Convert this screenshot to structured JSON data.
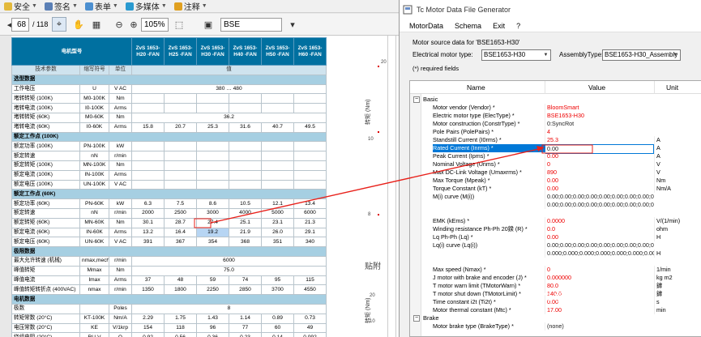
{
  "pdf_toolbar": {
    "menus": [
      {
        "label": "安全",
        "icon": "shield-icon"
      },
      {
        "label": "签名",
        "icon": "pen-icon"
      },
      {
        "label": "表单",
        "icon": "form-icon"
      },
      {
        "label": "多媒体",
        "icon": "media-icon"
      },
      {
        "label": "注释",
        "icon": "comment-icon"
      }
    ],
    "page_current": "68",
    "page_total": "/ 118",
    "zoom": "105%",
    "search_value": "BSE"
  },
  "datasheet": {
    "header": {
      "title": "电机型号",
      "models": [
        "ZvS 1653-H20 -FAN",
        "ZvS 1653-H25 -FAN",
        "ZvS 1653-H30 -FAN",
        "ZvS 1653-H40 -FAN",
        "ZvS 1653-H50 -FAN",
        "ZvS 1653-H60 -FAN"
      ]
    },
    "subheader": [
      "技术参数",
      "缩写符号",
      "单位",
      "值"
    ],
    "rows": [
      {
        "type": "sec",
        "label": "选型数据"
      },
      {
        "label": "工作电压",
        "sym": "U",
        "unit": "V AC",
        "span": "380 … 480"
      },
      {
        "label": "堵转转矩 (100K)",
        "sym": "M0-100K",
        "unit": "Nm",
        "vals": [
          "",
          "",
          "",
          "",
          "",
          ""
        ]
      },
      {
        "label": "堵转电流 (100K)",
        "sym": "I0-100K",
        "unit": "Arms",
        "vals": [
          "",
          "",
          "",
          "",
          "",
          ""
        ]
      },
      {
        "label": "堵转转矩 (60K)",
        "sym": "M0-60K",
        "unit": "Nm",
        "span": "36.2"
      },
      {
        "label": "堵转电流 (60K)",
        "sym": "I0-60K",
        "unit": "Arms",
        "vals": [
          "15.8",
          "20.7",
          "25.3",
          "31.6",
          "40.7",
          "49.5"
        ]
      },
      {
        "type": "sec",
        "label": "额定工作点 (100K)"
      },
      {
        "label": "额定功率 (100K)",
        "sym": "PN-100K",
        "unit": "kW",
        "vals": [
          "",
          "",
          "",
          "",
          "",
          ""
        ]
      },
      {
        "label": "额定转速",
        "sym": "nN",
        "unit": "r/min",
        "vals": [
          "",
          "",
          "",
          "",
          "",
          ""
        ]
      },
      {
        "label": "额定转矩 (100K)",
        "sym": "MN-100K",
        "unit": "Nm",
        "vals": [
          "",
          "",
          "",
          "",
          "",
          ""
        ]
      },
      {
        "label": "额定电流 (100K)",
        "sym": "IN-100K",
        "unit": "Arms",
        "vals": [
          "",
          "",
          "",
          "",
          "",
          ""
        ]
      },
      {
        "label": "额定电压 (100K)",
        "sym": "UN-100K",
        "unit": "V AC",
        "vals": [
          "",
          "",
          "",
          "",
          "",
          ""
        ]
      },
      {
        "type": "sec",
        "label": "额定工作点 (60K)"
      },
      {
        "label": "额定功率 (60K)",
        "sym": "PN-60K",
        "unit": "kW",
        "vals": [
          "6.3",
          "7.5",
          "8.6",
          "10.5",
          "12.1",
          "13.4"
        ]
      },
      {
        "label": "额定转速",
        "sym": "nN",
        "unit": "r/min",
        "vals": [
          "2000",
          "2500",
          "3000",
          "4000",
          "5000",
          "6000"
        ]
      },
      {
        "label": "额定转矩 (60K)",
        "sym": "MN-60K",
        "unit": "Nm",
        "vals": [
          "30.1",
          "28.7",
          "27.4",
          "25.1",
          "23.1",
          "21.3"
        ]
      },
      {
        "label": "额定电流 (60K)",
        "sym": "IN-60K",
        "unit": "Arms",
        "vals": [
          "13.2",
          "16.4",
          "19.2",
          "21.9",
          "26.0",
          "29.1"
        ],
        "hl": 2
      },
      {
        "label": "额定电压 (60K)",
        "sym": "UN-60K",
        "unit": "V AC",
        "vals": [
          "391",
          "367",
          "354",
          "368",
          "351",
          "340"
        ]
      },
      {
        "type": "sec",
        "label": "极限数据"
      },
      {
        "label": "最大允许转速 (机械)",
        "sym": "nmax,mech",
        "unit": "r/min",
        "span": "6000"
      },
      {
        "label": "峰值转矩",
        "sym": "Mmax",
        "unit": "Nm",
        "span": "75.0"
      },
      {
        "label": "峰值电流",
        "sym": "Imax",
        "unit": "Arms",
        "vals": [
          "37",
          "48",
          "59",
          "74",
          "95",
          "115"
        ]
      },
      {
        "label": "峰值转矩转折点 (400VAC)",
        "sym": "nmax",
        "unit": "r/min",
        "vals": [
          "1350",
          "1800",
          "2250",
          "2850",
          "3700",
          "4550"
        ]
      },
      {
        "type": "sec",
        "label": "电机数据"
      },
      {
        "label": "极数",
        "sym": "",
        "unit": "Poles",
        "span": "8"
      },
      {
        "label": "转矩常数 (20°C)",
        "sym": "KT-100K",
        "unit": "Nm/A",
        "vals": [
          "2.29",
          "1.75",
          "1.43",
          "1.14",
          "0.89",
          "0.73"
        ]
      },
      {
        "label": "电压常数 (20°C)",
        "sym": "KE",
        "unit": "V/1krp",
        "vals": [
          "154",
          "118",
          "96",
          "77",
          "60",
          "49"
        ]
      },
      {
        "label": "绕组电阻 (20°C)",
        "sym": "RU-V",
        "unit": "Ω",
        "vals": [
          "0.92",
          "0.56",
          "0.36",
          "0.23",
          "0.14",
          "0.092"
        ]
      },
      {
        "label": "绕组电感 (20°C)",
        "sym": "LU-V",
        "unit": "mH",
        "vals": [
          "19.2",
          "11.2",
          "7.50",
          "4.80",
          "2.90",
          "1.96"
        ]
      }
    ]
  },
  "chart_strip": {
    "numbers": [
      "20",
      "10",
      "8",
      "20",
      "10"
    ],
    "axis_titles": [
      "转矩 (Nm)",
      "转矩 (Nm)"
    ],
    "chinese_text": "贴附"
  },
  "tc": {
    "title": "Tc Motor Data File Generator",
    "menu": [
      "MotorData",
      "Schema",
      "Exit",
      "?"
    ],
    "source_text": "Motor source data for 'BSE1653-H30'",
    "elec_label": "Electrical motor type:",
    "elec_value": "BSE1653-H30",
    "assy_label": "AssemblyType:",
    "assy_value": "BSE1653-H30_Assembly",
    "required_text": "(*) required fields",
    "columns": [
      "Name",
      "Value",
      "Unit"
    ],
    "cat_basic": "Basic",
    "cat_brake": "Brake",
    "rows": [
      {
        "n": "Motor vendor (Vendor) *",
        "v": "BloomSmart",
        "u": "",
        "vc": "red"
      },
      {
        "n": "Electric motor type (ElecType) *",
        "v": "BSE1653-H30",
        "u": "",
        "vc": "red"
      },
      {
        "n": "Motor construction (ConstrType) *",
        "v": "0:SyncRot",
        "u": "",
        "vc": "blk"
      },
      {
        "n": "Pole Pairs (PolePairs) *",
        "v": "4",
        "u": "",
        "vc": "red"
      },
      {
        "n": "Standstill Current (I0rms) *",
        "v": "25.3",
        "u": "A",
        "vc": "red"
      },
      {
        "n": "Rated Current (Inrms) *",
        "v": "0.00",
        "u": "A",
        "vc": "blk",
        "sel": true
      },
      {
        "n": "Peak Current (Ipms) *",
        "v": "0.00",
        "u": "A",
        "vc": "red"
      },
      {
        "n": "Nominal Voltage (Unms) *",
        "v": "0",
        "u": "V",
        "vc": "red"
      },
      {
        "n": "Max DC-Link Voltage (Umaxrms) *",
        "v": "890",
        "u": "V",
        "vc": "red"
      },
      {
        "n": "Max Torque (Mpeak) *",
        "v": "0.00",
        "u": "Nm",
        "vc": "red"
      },
      {
        "n": "Torque Constant (kT) *",
        "v": "0.00",
        "u": "Nm/A",
        "vc": "red"
      },
      {
        "n": "M(i) curve (M(i))",
        "v": "0.00;0.00;0.00;0.00;0.00;0.00;0.00;0.00;0.00;0.",
        "u": "",
        "vc": "blk"
      },
      {
        "n": "",
        "v": "0.00;0.00;0.00;0.00;0.00;0.00;0.00;0.00;0.00;0.",
        "u": "",
        "vc": "blk"
      },
      {
        "n": "",
        "v": "",
        "u": "",
        "vc": "blk"
      },
      {
        "n": "EMK (kEms) *",
        "v": "0.0000",
        "u": "V/(1/min)",
        "vc": "red"
      },
      {
        "n": "Winding resistance Ph-Ph 20鍨 (R) *",
        "v": "0.0",
        "u": "ohm",
        "vc": "red"
      },
      {
        "n": "Lq Ph-Ph (Lq) *",
        "v": "0.00",
        "u": "H",
        "vc": "red"
      },
      {
        "n": "Lq(i) curve (Lq(i))",
        "v": "0.00;0.00;0.00;0.00;0.00;0.00;0.00;0.00;0.00;0.",
        "u": "",
        "vc": "blk"
      },
      {
        "n": "",
        "v": "0.000;0.000;0.000;0.000;0.000;0.000;0.000;0.000;",
        "u": "H",
        "vc": "blk"
      },
      {
        "n": "",
        "v": "",
        "u": "",
        "vc": "blk"
      },
      {
        "n": "Max speed (Nmax) *",
        "v": "0",
        "u": "1/min",
        "vc": "red"
      },
      {
        "n": "J motor with brake and encoder (J) *",
        "v": "0.000000",
        "u": "kg m2",
        "vc": "red"
      },
      {
        "n": "T motor warn limit (TMotorWarn) *",
        "v": "80.0",
        "u": "鎼",
        "vc": "red"
      },
      {
        "n": "T motor shut down (TMotorLimit) *",
        "v": "140.0",
        "u": "鎼",
        "vc": "red"
      },
      {
        "n": "Time constant i2t (Ti2t) *",
        "v": "0.00",
        "u": "s",
        "vc": "red"
      },
      {
        "n": "Motor thermal constant (Mtc) *",
        "v": "17.00",
        "u": "min",
        "vc": "red"
      }
    ],
    "brake_row": {
      "n": "Motor brake type (BrakeType) *",
      "v": "(none)",
      "u": "",
      "vc": "blk"
    }
  },
  "watermark": "CSDN @光怪陆离的节日",
  "colors": {
    "header_teal": "#0070a0",
    "section_blue": "#a6cfe2",
    "accent_red": "#e8201a",
    "selection_blue": "#0078d7"
  }
}
